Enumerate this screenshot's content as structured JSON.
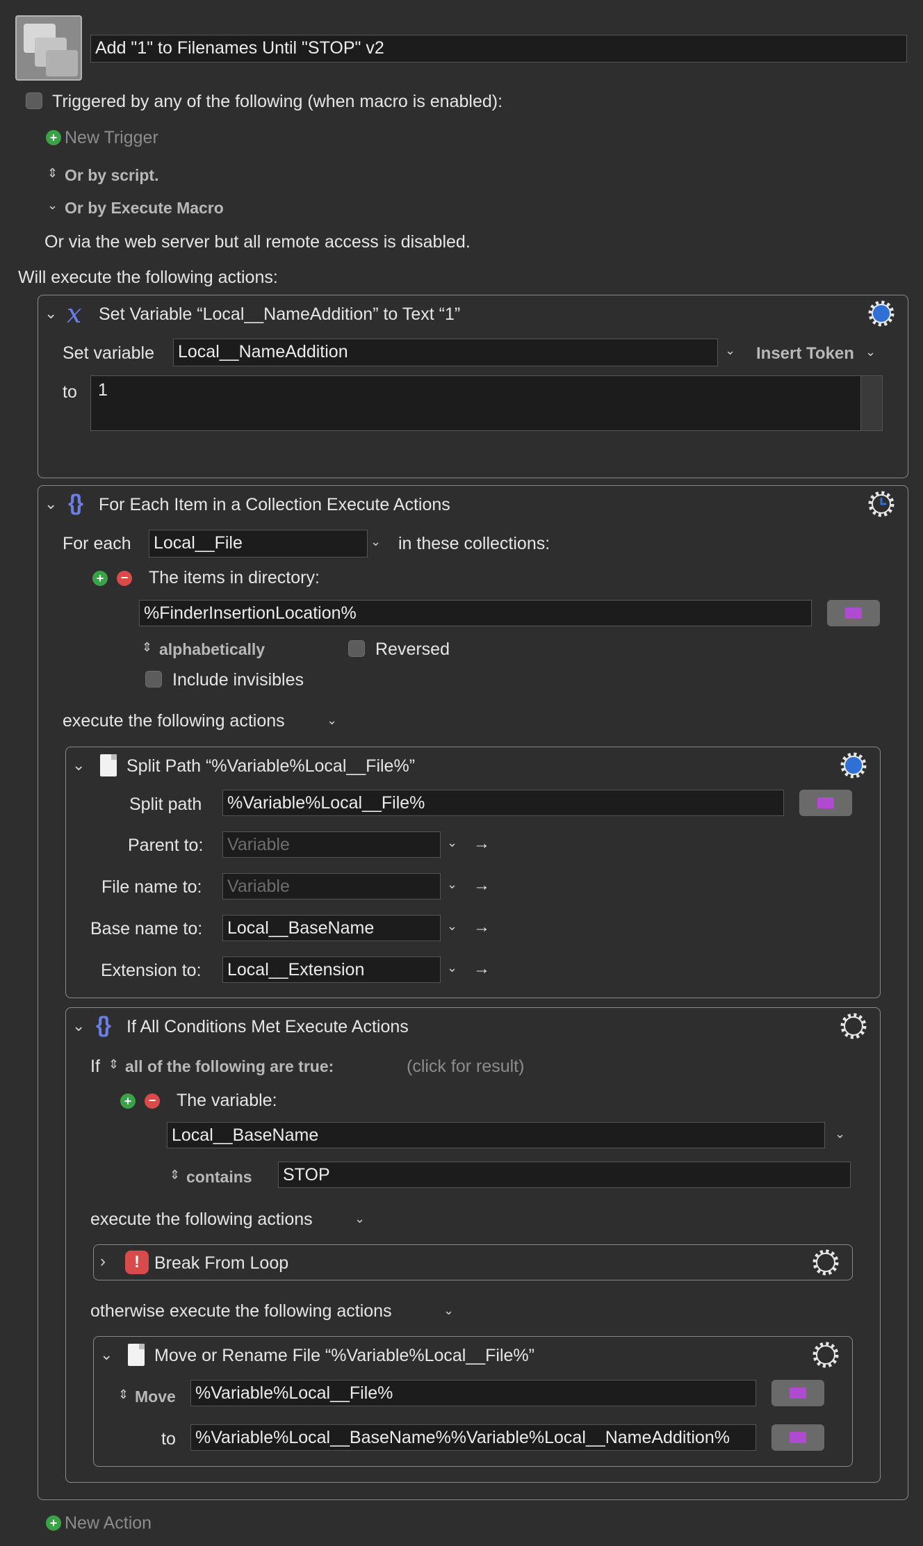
{
  "macro": {
    "name": "Add \"1\" to Filenames Until \"STOP\" v2",
    "trigger_label": "Triggered by any of the following (when macro is enabled):",
    "new_trigger": "New Trigger",
    "or_by_script": "Or by script.",
    "or_by_execute": "Or by Execute Macro",
    "web_server": "Or via the web server but all remote access is disabled.",
    "will_execute": "Will execute the following actions:",
    "new_action": "New Action"
  },
  "action1": {
    "title": "Set Variable “Local__NameAddition” to Text “1”",
    "set_variable_label": "Set variable",
    "variable": "Local__NameAddition",
    "insert_token": "Insert Token",
    "to_label": "to",
    "value": "1"
  },
  "action2": {
    "title": "For Each Item in a Collection Execute Actions",
    "for_each_label": "For each",
    "variable": "Local__File",
    "in_collections": "in these collections:",
    "items_in_directory": "The items in directory:",
    "directory": "%FinderInsertionLocation%",
    "sort": "alphabetically",
    "reversed": "Reversed",
    "include_invisibles": "Include invisibles",
    "execute_label": "execute the following actions"
  },
  "split": {
    "title": "Split Path “%Variable%Local__File%”",
    "split_path_label": "Split path",
    "path": "%Variable%Local__File%",
    "parent_label": "Parent to:",
    "parent_placeholder": "Variable",
    "filename_label": "File name to:",
    "filename_placeholder": "Variable",
    "basename_label": "Base name to:",
    "basename": "Local__BaseName",
    "extension_label": "Extension to:",
    "extension": "Local__Extension"
  },
  "ifblock": {
    "title": "If All Conditions Met Execute Actions",
    "if_label": "If",
    "condition_mode": "all of the following are true:",
    "click_result": "(click for result)",
    "the_variable": "The variable:",
    "variable": "Local__BaseName",
    "operator": "contains",
    "value": "STOP",
    "execute_label": "execute the following actions",
    "break_title": "Break From Loop",
    "otherwise_label": "otherwise execute the following actions"
  },
  "move": {
    "title": "Move or Rename File “%Variable%Local__File%”",
    "mode": "Move",
    "source": "%Variable%Local__File%",
    "to_label": "to",
    "destination": "%Variable%Local__BaseName%%Variable%Local__NameAddition%"
  },
  "colors": {
    "background": "#2e2e2e",
    "field": "#1c1c1c",
    "accent_blue": "#2f6fd6",
    "token_purple": "#b04ad1",
    "add_green": "#3aa347",
    "remove_red": "#d94a4a"
  }
}
